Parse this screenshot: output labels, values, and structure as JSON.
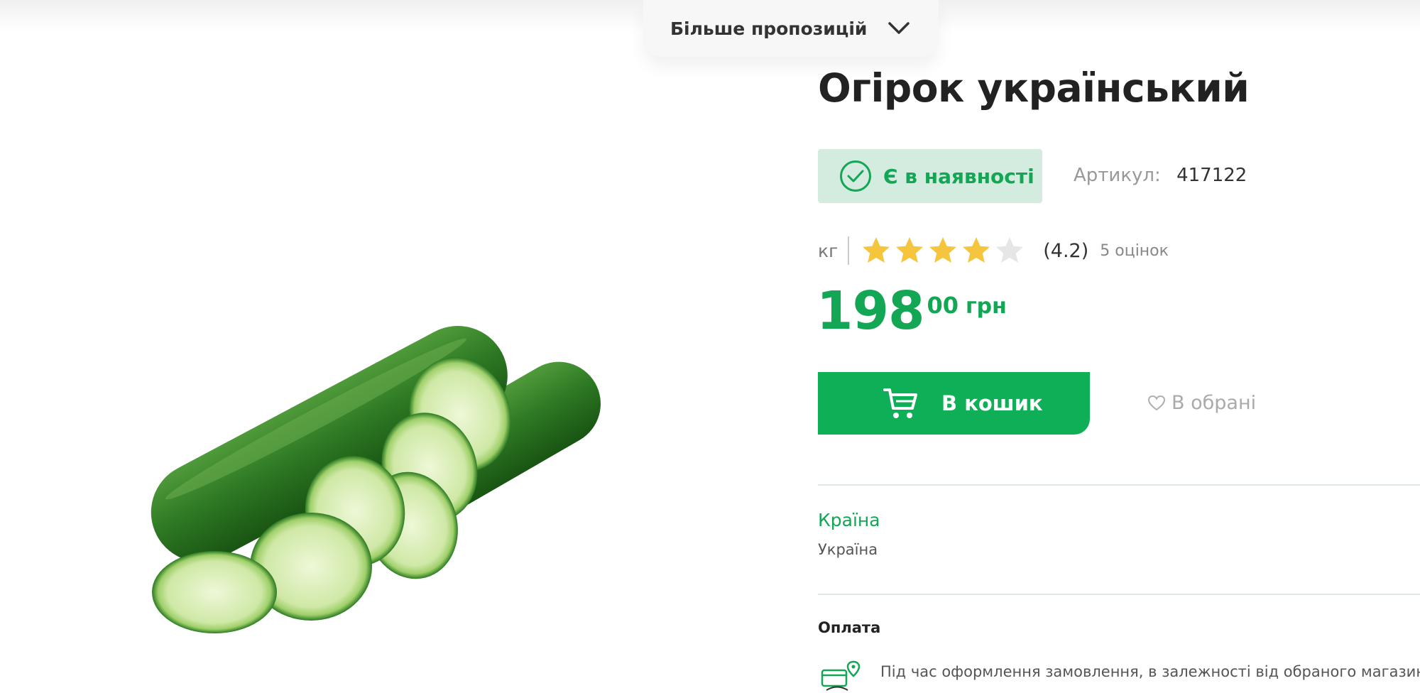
{
  "more_offers": {
    "label": "Більше пропозицій",
    "icon": "chevron-down-icon"
  },
  "product": {
    "title": "Огірок український",
    "image_icon": "cucumber-image"
  },
  "stock": {
    "label": "Є в наявності",
    "icon": "check-circle-icon",
    "color": "#13a654"
  },
  "sku": {
    "label": "Артикул:",
    "value": "417122"
  },
  "unit": "кг",
  "rating": {
    "value_text": "(4.2)",
    "count_text": "5 оцінок",
    "value": 4.2,
    "stars_filled": 4,
    "stars_total": 5,
    "star_color": "#f5c53d",
    "empty_star_color": "#e6e6e6"
  },
  "price": {
    "integer": "198",
    "decimal": "00",
    "currency": "грн"
  },
  "actions": {
    "cart_label": "В кошик",
    "cart_icon": "cart-icon",
    "favorite_label": "В обрані",
    "favorite_icon": "heart-icon"
  },
  "attributes": {
    "country_label": "Країна",
    "country_value": "Україна"
  },
  "payment": {
    "title": "Оплата",
    "icon": "payment-delivery-icon",
    "text": "Під час оформлення замовлення, в залежності від обраного магазину"
  },
  "colors": {
    "accent": "#0eaf57",
    "badge_bg": "#d4ebdf",
    "text": "#222222"
  }
}
